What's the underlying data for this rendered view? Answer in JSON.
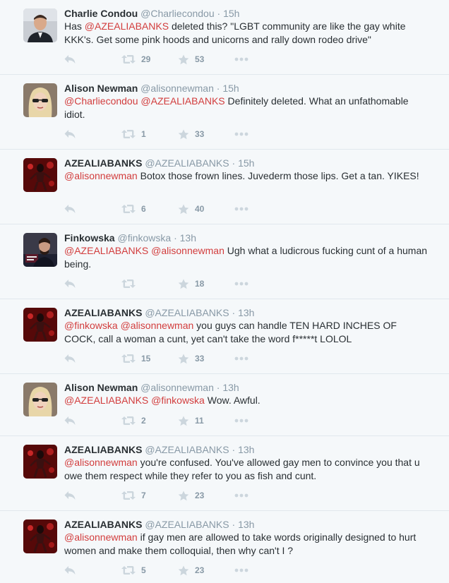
{
  "colors": {
    "background": "#f5f8fa",
    "mention": "#d23d3d",
    "meta": "#8899a6",
    "icon": "#ccd6dd",
    "text": "#292f33"
  },
  "tweets": [
    {
      "fullname": "Charlie Condou",
      "username": "@Charliecondou",
      "sep": "·",
      "time": "15h",
      "avatar": "charlie-avatar",
      "parts": [
        {
          "t": "Has ",
          "m": false
        },
        {
          "t": "@AZEALIABANKS",
          "m": true
        },
        {
          "t": " deleted this? \"LGBT community are like the gay white KKK's. Get some pink hoods and unicorns and rally down rodeo drive\"",
          "m": false
        }
      ],
      "retweets": "29",
      "favorites": "53"
    },
    {
      "fullname": "Alison Newman",
      "username": "@alisonnewman",
      "sep": "·",
      "time": "15h",
      "avatar": "alison-avatar",
      "parts": [
        {
          "t": "@Charliecondou",
          "m": true
        },
        {
          "t": " ",
          "m": false
        },
        {
          "t": "@AZEALIABANKS",
          "m": true
        },
        {
          "t": " Definitely deleted. What an unfathomable idiot.",
          "m": false
        }
      ],
      "retweets": "1",
      "favorites": "33"
    },
    {
      "fullname": "AZEALIABANKS",
      "username": "@AZEALIABANKS",
      "sep": "·",
      "time": "15h",
      "avatar": "azealia-avatar",
      "parts": [
        {
          "t": "@alisonnewman",
          "m": true
        },
        {
          "t": " Botox those frown lines. Juvederm those lips. Get a tan. YIKES!",
          "m": false
        }
      ],
      "retweets": "6",
      "favorites": "40"
    },
    {
      "fullname": "Finkowska",
      "username": "@finkowska",
      "sep": "·",
      "time": "13h",
      "avatar": "finkowska-avatar",
      "parts": [
        {
          "t": "@AZEALIABANKS",
          "m": true
        },
        {
          "t": " ",
          "m": false
        },
        {
          "t": "@alisonnewman",
          "m": true
        },
        {
          "t": " Ugh what a ludicrous fucking cunt of a human being.",
          "m": false
        }
      ],
      "retweets": "",
      "favorites": "18"
    },
    {
      "fullname": "AZEALIABANKS",
      "username": "@AZEALIABANKS",
      "sep": "·",
      "time": "13h",
      "avatar": "azealia-avatar",
      "parts": [
        {
          "t": "@finkowska",
          "m": true
        },
        {
          "t": " ",
          "m": false
        },
        {
          "t": "@alisonnewman",
          "m": true
        },
        {
          "t": " you guys can handle TEN HARD INCHES OF COCK, call a woman a cunt, yet can't take the word f*****t LOLOL",
          "m": false
        }
      ],
      "retweets": "15",
      "favorites": "33"
    },
    {
      "fullname": "Alison Newman",
      "username": "@alisonnewman",
      "sep": "·",
      "time": "13h",
      "avatar": "alison-avatar",
      "parts": [
        {
          "t": "@AZEALIABANKS",
          "m": true
        },
        {
          "t": " ",
          "m": false
        },
        {
          "t": "@finkowska",
          "m": true
        },
        {
          "t": " Wow. Awful.",
          "m": false
        }
      ],
      "retweets": "2",
      "favorites": "11"
    },
    {
      "fullname": "AZEALIABANKS",
      "username": "@AZEALIABANKS",
      "sep": "·",
      "time": "13h",
      "avatar": "azealia-avatar",
      "parts": [
        {
          "t": "@alisonnewman",
          "m": true
        },
        {
          "t": " you're confused. You've allowed gay men to convince you that u owe them respect while they refer to you as fish and cunt.",
          "m": false
        }
      ],
      "retweets": "7",
      "favorites": "23"
    },
    {
      "fullname": "AZEALIABANKS",
      "username": "@AZEALIABANKS",
      "sep": "·",
      "time": "13h",
      "avatar": "azealia-avatar",
      "parts": [
        {
          "t": "@alisonnewman",
          "m": true
        },
        {
          "t": " if gay men are allowed to take words originally designed to hurt women and make them colloquial, then why can't I ?",
          "m": false
        }
      ],
      "retweets": "5",
      "favorites": "23"
    }
  ]
}
